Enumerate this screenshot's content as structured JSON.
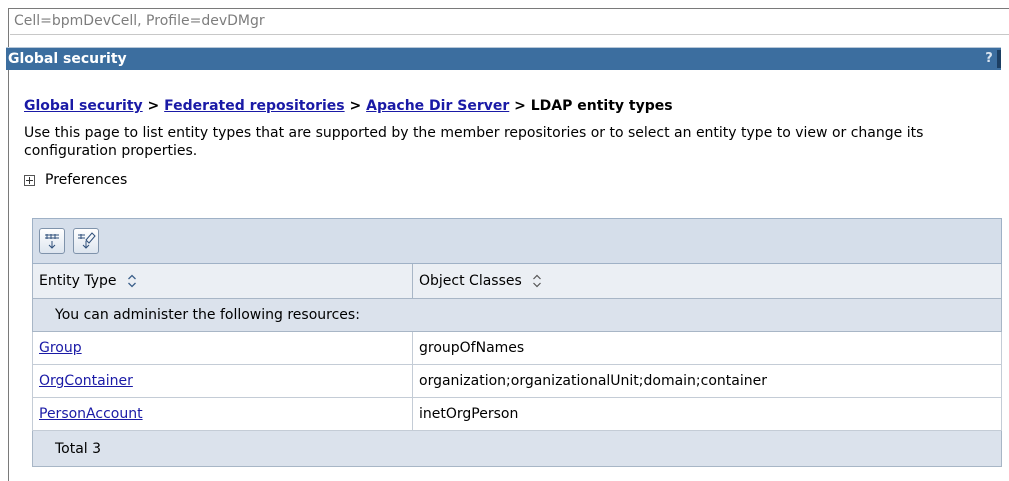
{
  "cell_profile": "Cell=bpmDevCell, Profile=devDMgr",
  "panel": {
    "title": "Global security",
    "help_label": "?"
  },
  "breadcrumb": {
    "items": [
      "Global security",
      "Federated repositories",
      "Apache Dir Server"
    ],
    "separator": ">",
    "current": "LDAP entity types"
  },
  "description": "Use this page to list entity types that are supported by the member repositories or to select an entity type to view or change its configuration properties.",
  "preferences": {
    "label": "Preferences"
  },
  "toolbar": {
    "buttons": [
      "select-all-icon",
      "deselect-all-icon"
    ]
  },
  "table": {
    "columns": [
      "Entity Type",
      "Object Classes"
    ],
    "admin_message": "You can administer the following resources:",
    "rows": [
      {
        "entity_type": "Group",
        "object_classes": "groupOfNames"
      },
      {
        "entity_type": "OrgContainer",
        "object_classes": "organization;organizationalUnit;domain;container"
      },
      {
        "entity_type": "PersonAccount",
        "object_classes": "inetOrgPerson"
      }
    ],
    "total": "Total 3"
  },
  "colors": {
    "title_bar": "#3c6e9f",
    "link": "#1a1aa6",
    "table_header_bg": "#ebeff4",
    "toolbar_bg": "#d5deea"
  }
}
